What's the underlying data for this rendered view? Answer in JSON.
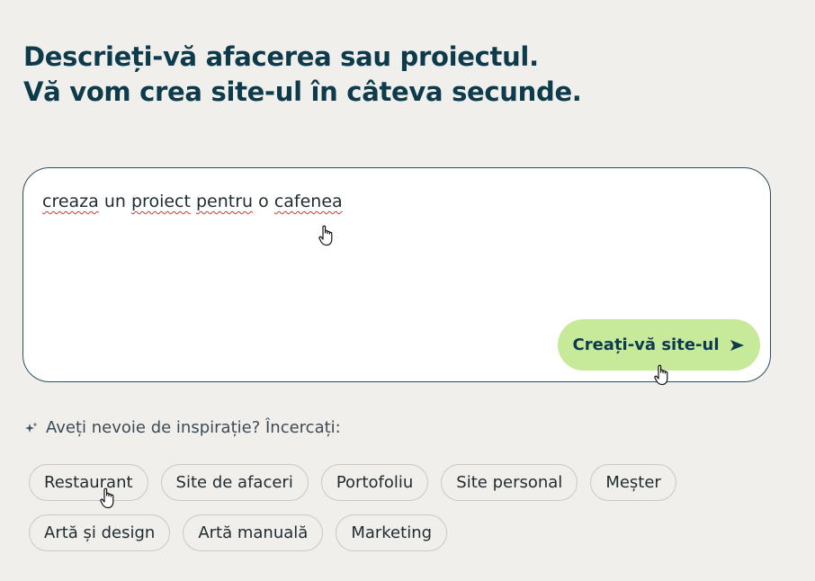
{
  "heading": {
    "line1": "Descrieți-vă afacerea sau proiectul.",
    "line2": "Vă vom crea site-ul în câteva secunde."
  },
  "prompt": {
    "value": "creaza un proiect pentru o cafenea",
    "words": [
      "creaza",
      "un",
      "proiect",
      "pentru",
      "o",
      "cafenea"
    ]
  },
  "create_button": {
    "label": "Creați-vă site-ul",
    "icon": "send-arrow-icon"
  },
  "inspiration": {
    "icon": "sparkle-icon",
    "label": "Aveți nevoie de inspirație? Încercați:"
  },
  "chips": {
    "row1": [
      "Restaurant",
      "Site de afaceri",
      "Portofoliu",
      "Site personal",
      "Meșter"
    ],
    "row2": [
      "Artă și design",
      "Artă manuală",
      "Marketing"
    ]
  },
  "colors": {
    "background": "#f0efeb",
    "heading": "#0d3b4c",
    "button": "#c6e99a",
    "border": "#2f4f5a"
  }
}
